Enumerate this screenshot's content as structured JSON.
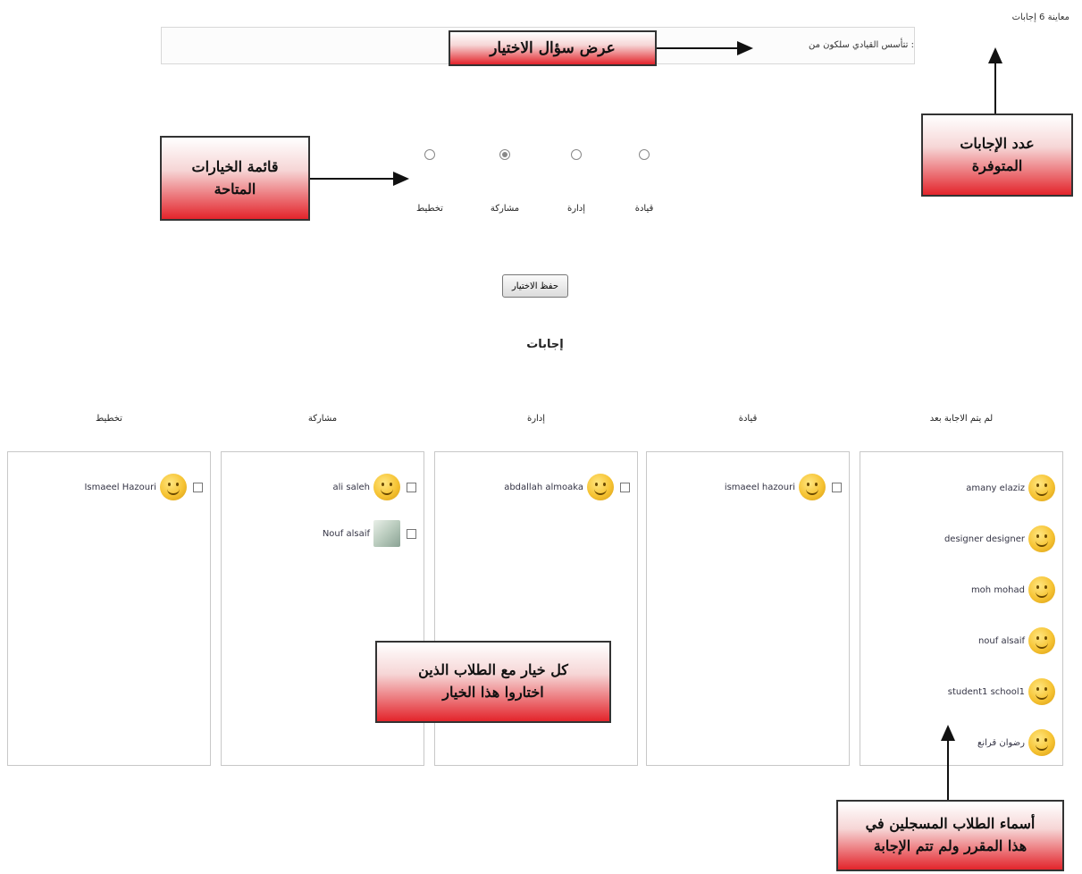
{
  "top_meta": {
    "answers_available": "معاينة 6 إجابات"
  },
  "question": {
    "text": "تتأسس القيادي سلكون من :"
  },
  "options": [
    {
      "label": "قيادة",
      "selected": false
    },
    {
      "label": "إدارة",
      "selected": false
    },
    {
      "label": "مشاركة",
      "selected": true
    },
    {
      "label": "تخطيط",
      "selected": false
    }
  ],
  "save_button": "حفظ الاختيار",
  "answers_title": "إجابات",
  "columns": [
    {
      "header": "لم يتم الاجابة بعد",
      "entries": [
        {
          "name": "amany elaziz",
          "avatar": "smiley-icon"
        },
        {
          "name": "designer designer",
          "avatar": "smiley-icon"
        },
        {
          "name": "moh mohad",
          "avatar": "smiley-icon"
        },
        {
          "name": "nouf alsaif",
          "avatar": "smiley-icon"
        },
        {
          "name": "student1 school1",
          "avatar": "smiley-icon"
        },
        {
          "name": "رضوان قرانع",
          "avatar": "smiley-icon"
        }
      ]
    },
    {
      "header": "قيادة",
      "entries": [
        {
          "name": "ismaeel hazouri",
          "avatar": "smiley-icon"
        }
      ]
    },
    {
      "header": "إدارة",
      "entries": [
        {
          "name": "abdallah almoaka",
          "avatar": "smiley-icon"
        }
      ]
    },
    {
      "header": "مشاركة",
      "entries": [
        {
          "name": "ali saleh",
          "avatar": "smiley-icon"
        },
        {
          "name": "Nouf alsaif",
          "avatar": "photo"
        }
      ]
    },
    {
      "header": "تخطيط",
      "entries": [
        {
          "name": "Ismaeel Hazouri",
          "avatar": "smiley-icon"
        }
      ]
    }
  ],
  "callouts": {
    "question_display": "عرض سؤال الاختيار",
    "answers_count": [
      "عدد الإجابات",
      "المتوفرة"
    ],
    "options_list": [
      "قائمة الخيارات",
      "المتاحة"
    ],
    "option_students": [
      "كل خيار مع الطلاب الذين",
      "اختاروا هذا الخيار"
    ],
    "unanswered_students": [
      "أسماء الطلاب المسجلين في",
      "هذا المقرر ولم تتم الإجابة"
    ]
  },
  "colors": {
    "callout_gradient_end": "#e3242b",
    "border": "#c8c8c8"
  }
}
